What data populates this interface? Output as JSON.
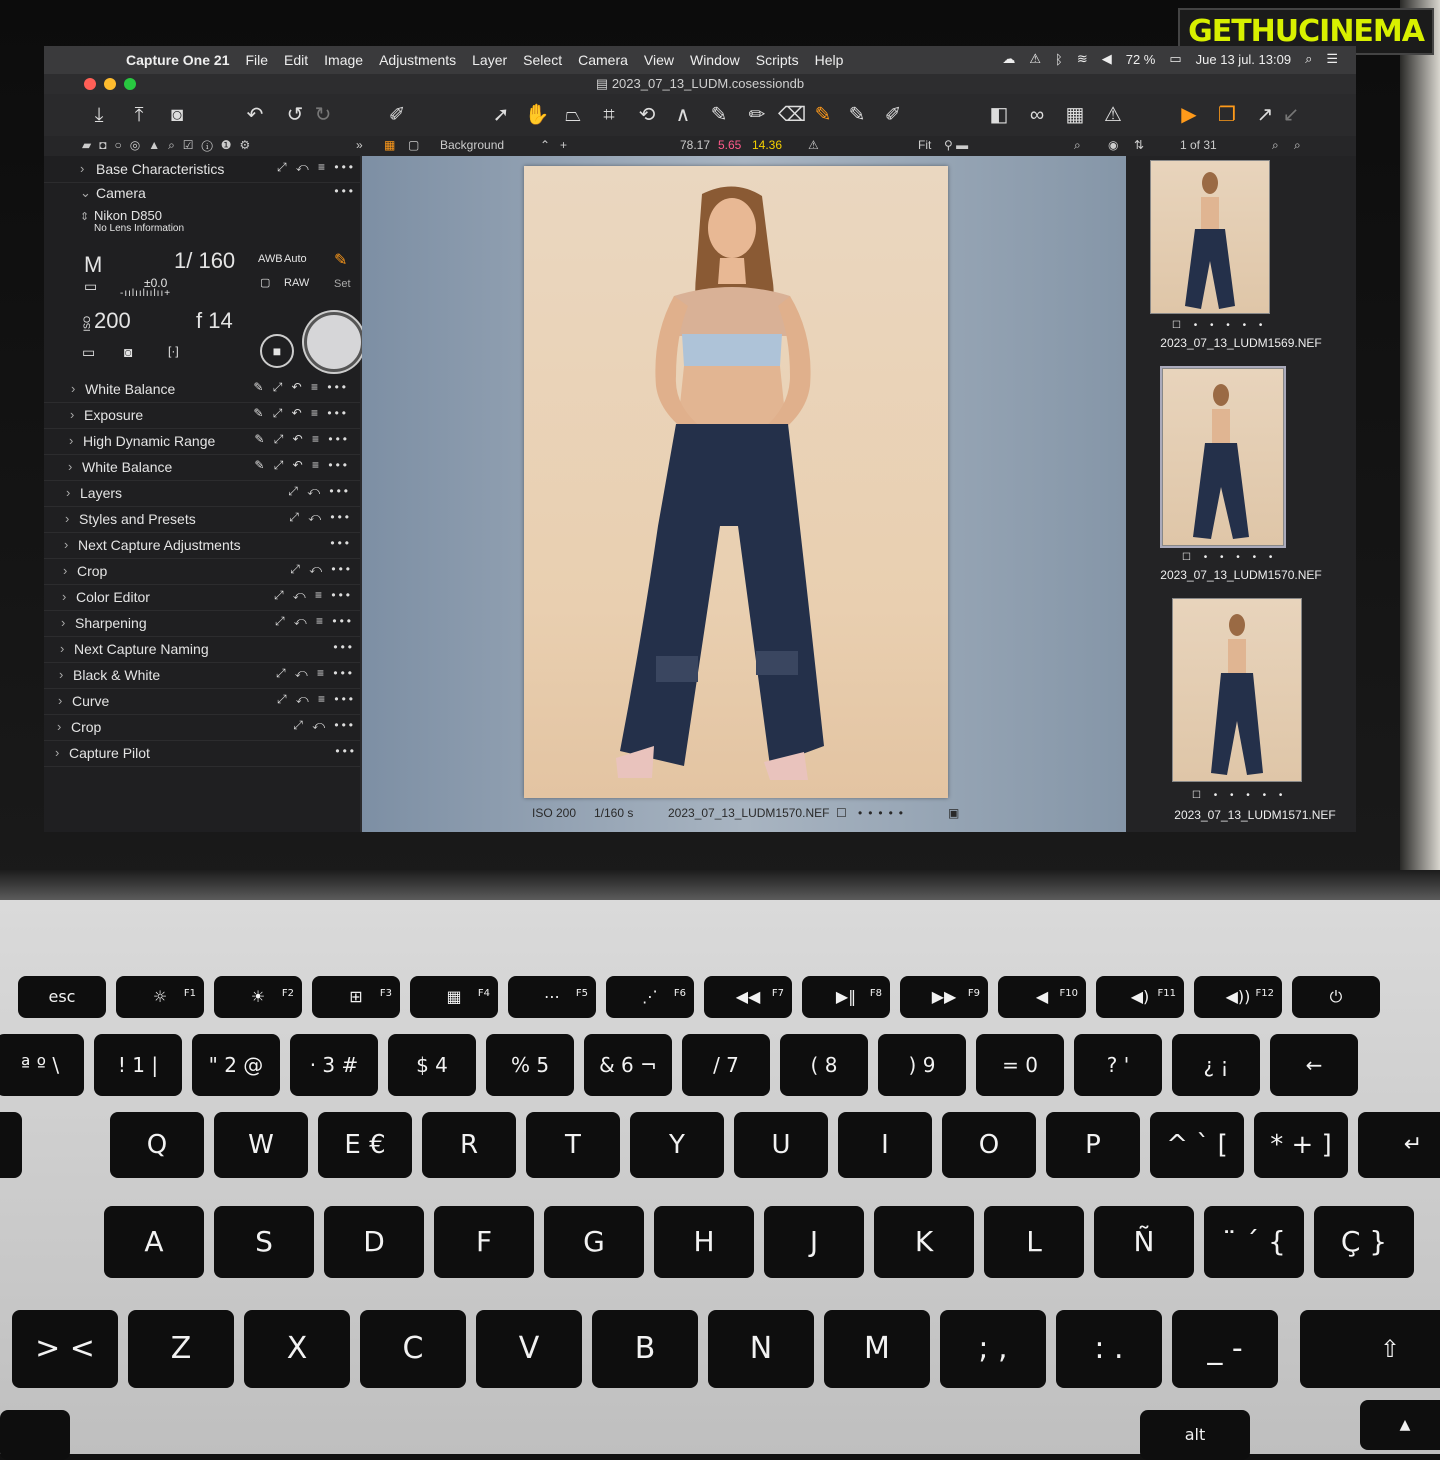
{
  "watermark": "GETHUCINEMA",
  "menubar": {
    "apple": "",
    "items": [
      "Capture One 21",
      "File",
      "Edit",
      "Image",
      "Adjustments",
      "Layer",
      "Select",
      "Camera",
      "View",
      "Window",
      "Scripts",
      "Help"
    ],
    "battery": "72 %",
    "datetime": "Jue 13 jul.  13:09"
  },
  "titlebar": {
    "filename": "2023_07_13_LUDM.cosessiondb"
  },
  "bar2": {
    "layer": "Background",
    "readout_l": "78.17",
    "readout_a": "5.65",
    "readout_b": "14.36",
    "zoom": "Fit",
    "counter": "1 of 31"
  },
  "colors": {
    "readout_a": "#ff5a8a",
    "readout_b": "#f5d000",
    "accent": "#ff9a1a"
  },
  "camera": {
    "section": "Camera",
    "model": "Nikon D850",
    "lens": "No Lens Information",
    "mode": "M",
    "shutter": "1/ 160",
    "awb": "Auto",
    "awb_label": "AWB",
    "format": "RAW",
    "set": "Set",
    "ev": "±0.0",
    "iso": "200",
    "aperture": "f 14"
  },
  "panels": [
    {
      "label": "Base Characteristics",
      "icons": "⤢ ↶ ≡ •••"
    },
    {
      "label": "White Balance",
      "icons": "✎ ⤢ ↶ ≡ •••"
    },
    {
      "label": "Exposure",
      "icons": "✎ ⤢ ↶ ≡ •••"
    },
    {
      "label": "High Dynamic Range",
      "icons": "✎ ⤢ ↶ ≡ •••"
    },
    {
      "label": "White Balance",
      "icons": "✎ ⤢ ↶ ≡ •••"
    },
    {
      "label": "Layers",
      "icons": "⤢ ↶ •••"
    },
    {
      "label": "Styles and Presets",
      "icons": "⤢ ↶ •••"
    },
    {
      "label": "Next Capture Adjustments",
      "icons": "•••"
    },
    {
      "label": "Crop",
      "icons": "⤢ ↶ •••"
    },
    {
      "label": "Color Editor",
      "icons": "⤢ ↶ ≡ •••"
    },
    {
      "label": "Sharpening",
      "icons": "⤢ ↶ ≡ •••"
    },
    {
      "label": "Next Capture Naming",
      "icons": "•••"
    },
    {
      "label": "Black & White",
      "icons": "⤢ ↶ ≡ •••"
    },
    {
      "label": "Curve",
      "icons": "⤢ ↶ ≡ •••"
    },
    {
      "label": "Crop",
      "icons": "⤢ ↶ •••"
    },
    {
      "label": "Capture Pilot",
      "icons": "•••"
    }
  ],
  "viewer": {
    "iso": "ISO 200",
    "shutter": "1/160 s",
    "filename": "2023_07_13_LUDM1570.NEF"
  },
  "filmstrip": [
    {
      "name": "2023_07_13_LUDM1569.NEF",
      "selected": false
    },
    {
      "name": "2023_07_13_LUDM1570.NEF",
      "selected": true
    },
    {
      "name": "2023_07_13_LUDM1571.NEF",
      "selected": false
    }
  ],
  "keyboard": {
    "fn_row": [
      {
        "label": "esc",
        "fn": ""
      },
      {
        "label": "☼",
        "fn": "F1"
      },
      {
        "label": "☀",
        "fn": "F2"
      },
      {
        "label": "⊞",
        "fn": "F3"
      },
      {
        "label": "▦",
        "fn": "F4"
      },
      {
        "label": "⋯",
        "fn": "F5"
      },
      {
        "label": "⋰",
        "fn": "F6"
      },
      {
        "label": "◀◀",
        "fn": "F7"
      },
      {
        "label": "▶‖",
        "fn": "F8"
      },
      {
        "label": "▶▶",
        "fn": "F9"
      },
      {
        "label": "◀",
        "fn": "F10"
      },
      {
        "label": "◀)",
        "fn": "F11"
      },
      {
        "label": "◀))",
        "fn": "F12"
      },
      {
        "label": "⏻",
        "fn": ""
      }
    ],
    "num_row": [
      "ª º \\",
      "! 1 |",
      "\" 2 @",
      "· 3 #",
      "$ 4",
      "% 5",
      "& 6 ¬",
      "/ 7",
      "( 8",
      ") 9",
      "= 0",
      "? '",
      "¿ ¡",
      "←"
    ],
    "qwerty_row": [
      "Q",
      "W",
      "E €",
      "R",
      "T",
      "Y",
      "U",
      "I",
      "O",
      "P",
      "^ ` [",
      "* + ]"
    ],
    "asdf_row": [
      "A",
      "S",
      "D",
      "F",
      "G",
      "H",
      "J",
      "K",
      "L",
      "Ñ",
      "¨ ´ {",
      "Ç }"
    ],
    "zxcv_row": [
      "> <",
      "Z",
      "X",
      "C",
      "V",
      "B",
      "N",
      "M",
      "; ,",
      ": .",
      "_ -"
    ],
    "alt": "alt"
  }
}
